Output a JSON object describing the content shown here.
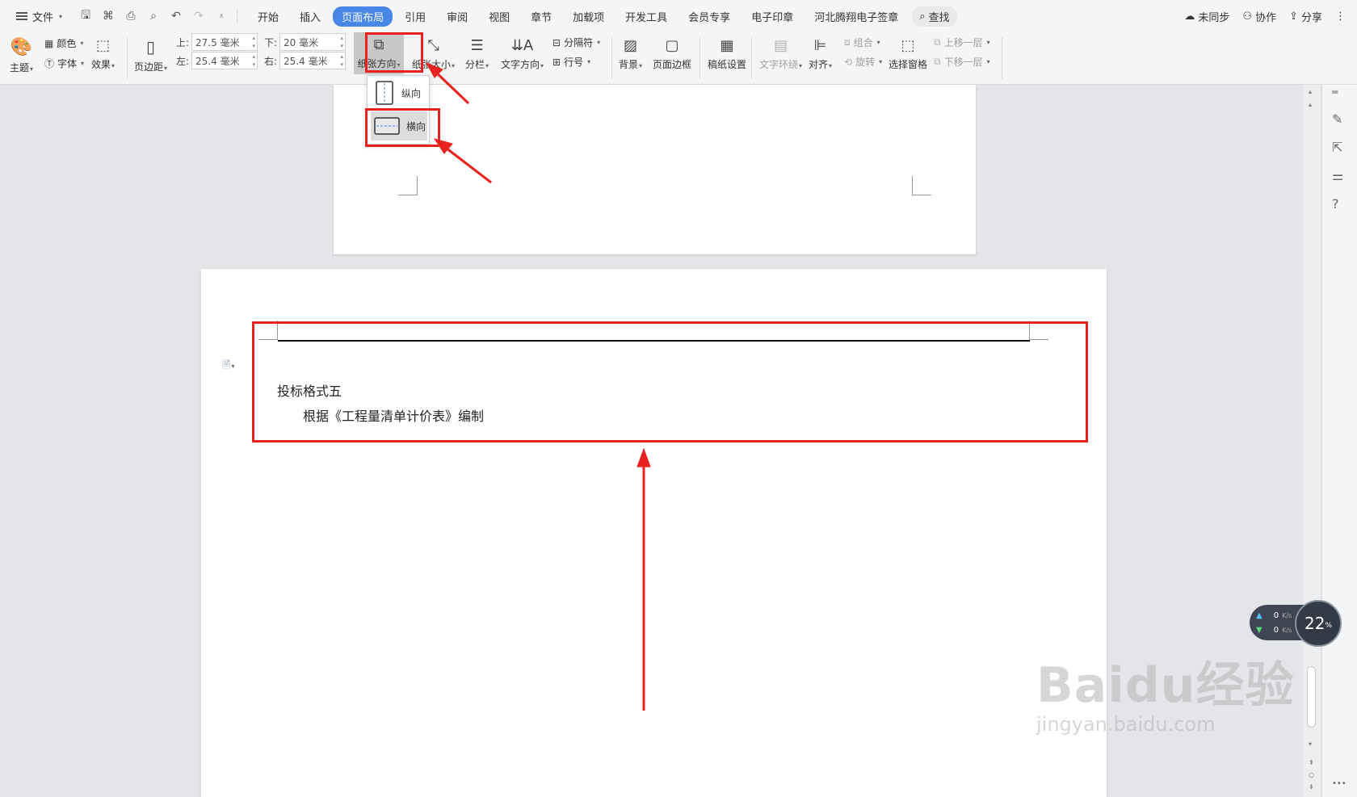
{
  "menubar": {
    "file_label": "文件",
    "tabs": [
      "开始",
      "插入",
      "页面布局",
      "引用",
      "审阅",
      "视图",
      "章节",
      "加载项",
      "开发工具",
      "会员专享",
      "电子印章",
      "河北腾翔电子签章"
    ],
    "active_tab": "页面布局",
    "search_label": "查找",
    "sync_label": "未同步",
    "collab_label": "协作",
    "share_label": "分享"
  },
  "ribbon": {
    "theme_label": "主题",
    "color_label": "颜色",
    "font_label": "字体",
    "effect_label": "效果",
    "margins_label": "页边距",
    "margin_top_label": "上:",
    "margin_top_value": "27.5 毫米",
    "margin_bottom_label": "下:",
    "margin_bottom_value": "20 毫米",
    "margin_left_label": "左:",
    "margin_left_value": "25.4 毫米",
    "margin_right_label": "右:",
    "margin_right_value": "25.4 毫米",
    "orientation_label": "纸张方向",
    "paper_size_label": "纸张大小",
    "columns_label": "分栏",
    "text_direction_label": "文字方向",
    "separator_label": "分隔符",
    "line_numbers_label": "行号",
    "background_label": "背景",
    "page_border_label": "页面边框",
    "manuscript_label": "稿纸设置",
    "text_wrap_label": "文字环绕",
    "align_label": "对齐",
    "group_label": "组合",
    "rotate_label": "旋转",
    "selection_pane_label": "选择窗格",
    "bring_forward_label": "上移一层",
    "send_backward_label": "下移一层"
  },
  "orientation_menu": {
    "portrait_label": "纵向",
    "landscape_label": "横向",
    "selected": "横向"
  },
  "document": {
    "heading_text": "投标格式五",
    "body_text": "根据《工程量清单计价表》编制"
  },
  "speed_widget": {
    "upload": "0",
    "download": "0",
    "unit": "K/s",
    "percent": "22",
    "percent_unit": "%"
  },
  "watermark": {
    "brand": "Baidu经验",
    "url": "jingyan.baidu.com"
  },
  "colors": {
    "accent_blue": "#4a86e8",
    "annotation_red": "#e8231f"
  }
}
